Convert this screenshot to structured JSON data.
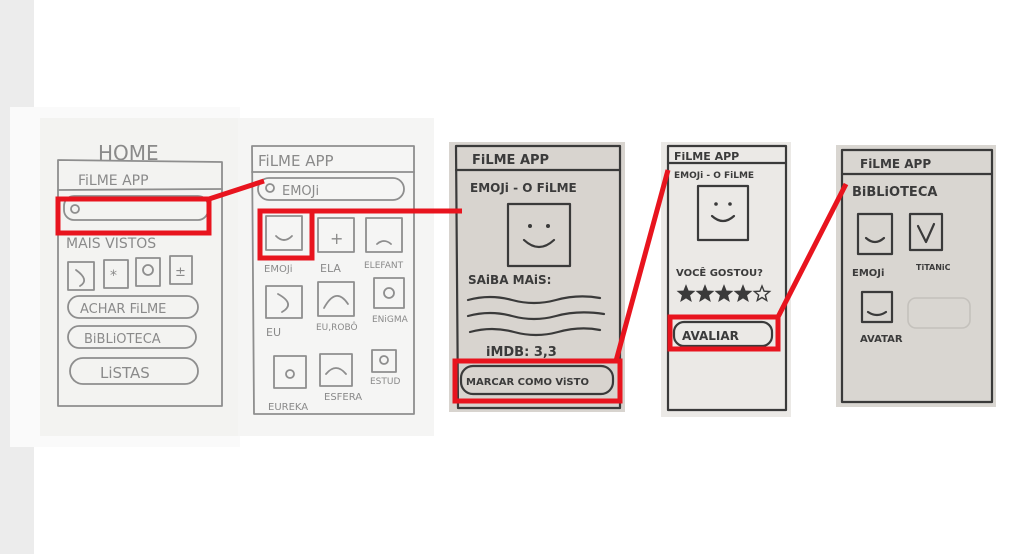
{
  "colors": {
    "highlight": "#e8141e",
    "pencil": "#8e8e8e",
    "pen": "#3a3a3a",
    "paper_light": "#f3f2ef",
    "paper_dark": "#d9d6d1"
  },
  "screen1": {
    "header": "HOME",
    "app_title": "FiLME APP",
    "section_title": "MAIS VISTOS",
    "buttons": [
      "ACHAR FiLME",
      "BiBLiOTECA",
      "LiSTAS"
    ],
    "icons": [
      "moon-icon",
      "star-icon",
      "flower-icon",
      "plus-minus-icon"
    ]
  },
  "screen2": {
    "app_title": "FiLME APP",
    "search_value": "EMOJi",
    "grid": [
      {
        "label": "EMOJi",
        "icon": "smiley-icon"
      },
      {
        "label": "ELA",
        "icon": "cross-icon"
      },
      {
        "label": "ELEFANT",
        "icon": "sad-face-icon"
      },
      {
        "label": "EU",
        "icon": "moon-icon"
      },
      {
        "label": "EU,ROBÔ",
        "icon": "arc-icon"
      },
      {
        "label": "ENiGMA",
        "icon": "flower-icon"
      },
      {
        "label": "EUREKA",
        "icon": "surprised-icon"
      },
      {
        "label": "ESFERA",
        "icon": "wave-icon"
      },
      {
        "label": "ESTUD",
        "icon": "flower-icon"
      }
    ]
  },
  "screen3": {
    "app_title": "FiLME APP",
    "movie_title": "EMOJi - O FiLME",
    "more_label": "SAiBA MAiS:",
    "imdb": "iMDB: 3,3",
    "mark_button": "MARCAR COMO ViSTO"
  },
  "screen4": {
    "app_title": "FiLME APP",
    "movie_title": "EMOJi - O FiLME",
    "question": "VOCÊ GOSTOU?",
    "rating": 4,
    "rating_max": 5,
    "rate_button": "AVALIAR"
  },
  "screen5": {
    "app_title": "FiLME APP",
    "section_title": "BiBLiOTECA",
    "items": [
      {
        "label": "EMOJi",
        "icon": "smiley-icon"
      },
      {
        "label": "TiTANiC",
        "icon": "heart-icon"
      },
      {
        "label": "AVATAR",
        "icon": "face-icon"
      }
    ]
  }
}
